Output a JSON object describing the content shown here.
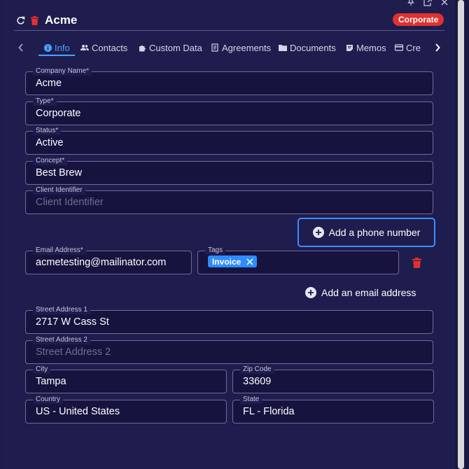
{
  "header": {
    "title": "Acme",
    "badge": "Corporate"
  },
  "window_icons": [
    "pin-icon",
    "popout-icon",
    "close-icon"
  ],
  "tabs": [
    {
      "label": "Info",
      "icon": "info-icon",
      "active": true
    },
    {
      "label": "Contacts",
      "icon": "people-icon"
    },
    {
      "label": "Custom Data",
      "icon": "puzzle-icon"
    },
    {
      "label": "Agreements",
      "icon": "document-icon"
    },
    {
      "label": "Documents",
      "icon": "folder-icon"
    },
    {
      "label": "Memos",
      "icon": "memo-icon"
    },
    {
      "label": "Cre",
      "icon": "credit-icon"
    }
  ],
  "form": {
    "company_name": {
      "label": "Company Name*",
      "value": "Acme"
    },
    "type": {
      "label": "Type*",
      "value": "Corporate"
    },
    "status": {
      "label": "Status*",
      "value": "Active"
    },
    "concept": {
      "label": "Concept*",
      "value": "Best Brew"
    },
    "client_identifier": {
      "label": "Client Identifier",
      "placeholder": "Client Identifier"
    },
    "add_phone_label": "Add a phone number",
    "email": {
      "label": "Email Address*",
      "value": "acmetesting@mailinator.com"
    },
    "tags": {
      "label": "Tags",
      "chips": [
        "Invoice"
      ]
    },
    "add_email_label": "Add an email address",
    "street1": {
      "label": "Street Address 1",
      "value": "2717 W Cass St"
    },
    "street2": {
      "label": "Street Address 2",
      "placeholder": "Street Address 2"
    },
    "city": {
      "label": "City",
      "value": "Tampa"
    },
    "zip": {
      "label": "Zip Code",
      "value": "33609"
    },
    "country": {
      "label": "Country",
      "value": "US - United States"
    },
    "state": {
      "label": "State",
      "value": "FL - Florida"
    }
  },
  "colors": {
    "accent": "#4aa3ff",
    "badge": "#e0312f",
    "delete": "#e0312f",
    "chip": "#2f8cff",
    "background": "#1f1d4e"
  }
}
